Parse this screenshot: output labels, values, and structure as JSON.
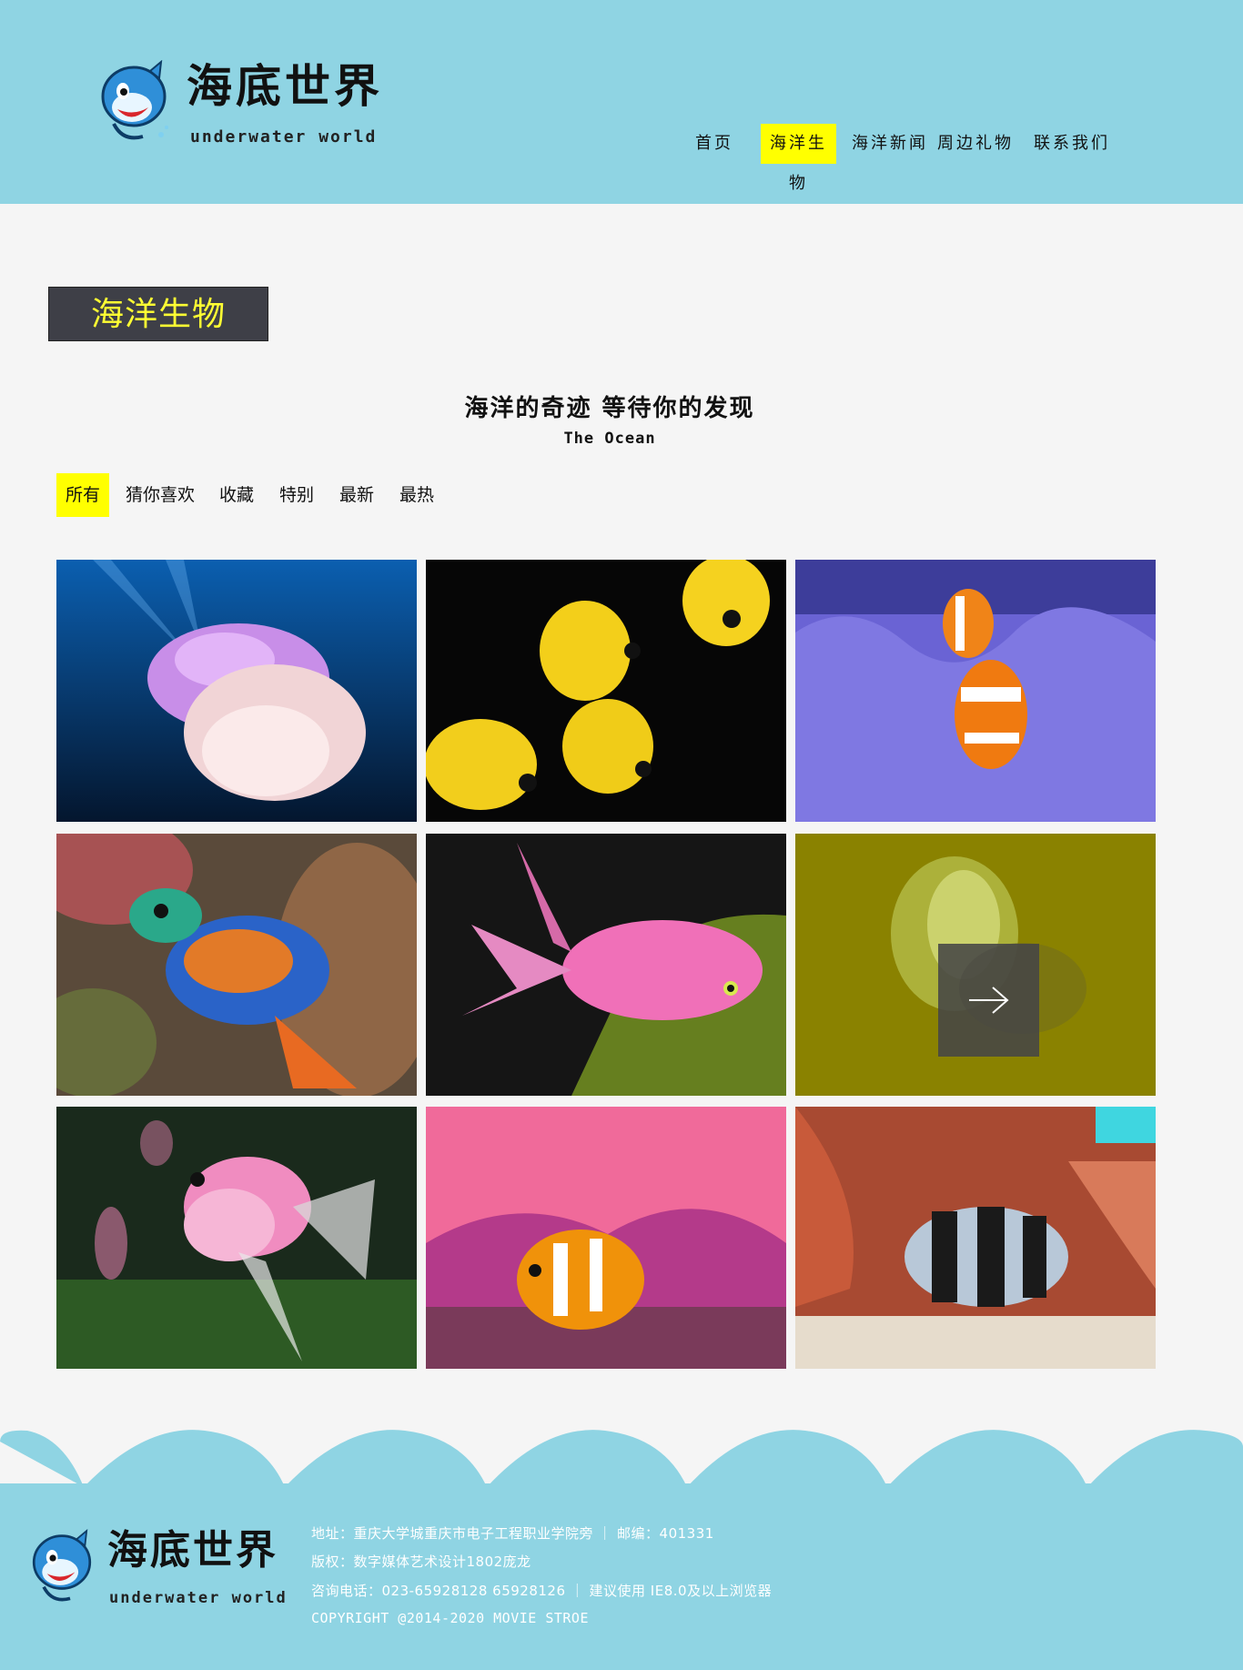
{
  "header": {
    "logo_title": "海底世界",
    "logo_subtitle": "underwater world",
    "nav": [
      {
        "label": "首页",
        "active": false
      },
      {
        "label": "海洋生物",
        "active": true
      },
      {
        "label": "海洋新闻",
        "active": false
      },
      {
        "label": "周边礼物",
        "active": false
      },
      {
        "label": "联系我们",
        "active": false
      }
    ]
  },
  "section": {
    "badge": "海洋生物",
    "headline": "海洋的奇迹 等待你的发现",
    "subheadline": "The Ocean"
  },
  "filters": [
    {
      "label": "所有",
      "active": true
    },
    {
      "label": "猜你喜欢",
      "active": false
    },
    {
      "label": "收藏",
      "active": false
    },
    {
      "label": "特别",
      "active": false
    },
    {
      "label": "最新",
      "active": false
    },
    {
      "label": "最热",
      "active": false
    }
  ],
  "gallery": {
    "items": [
      "jellyfish",
      "yellow-butterflyfish",
      "clownfish-anemone",
      "mandarinfish",
      "pink-anthias",
      "comb-jelly",
      "pink-angelfish",
      "clownfish-coral",
      "humbug-damselfish"
    ],
    "hover_item_index": 5,
    "hover_icon": "arrow-right-icon"
  },
  "footer": {
    "logo_title": "海底世界",
    "logo_subtitle": "underwater world",
    "address": "地址：重庆大学城重庆市电子工程职业学院旁 ｜ 邮编：401331",
    "copyright_cn": "版权：数字媒体艺术设计1802庞龙",
    "phone": "咨询电话：023-65928128 65928126 ｜ 建议使用 IE8.0及以上浏览器",
    "copyright": "COPYRIGHT @2014-2020 MOVIE STROE"
  },
  "colors": {
    "header_bg": "#8fd4e3",
    "accent": "#ffff00",
    "badge_bg": "#3e3f47",
    "badge_text": "#ffff33",
    "page_bg": "#f5f5f5"
  }
}
